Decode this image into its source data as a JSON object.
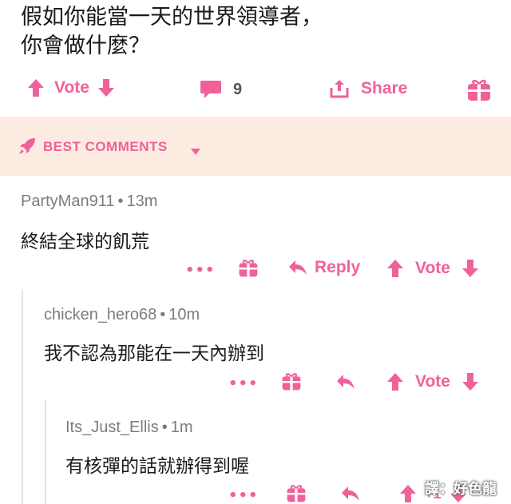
{
  "post": {
    "title": "假如你能當一天的世界領導者，\n你會做什麼？",
    "vote_label": "Vote",
    "comment_count": "9",
    "share_label": "Share"
  },
  "best_comments": {
    "label": "BEST COMMENTS"
  },
  "comments": [
    {
      "user": "PartyMan911",
      "age": "13m",
      "text": "終結全球的飢荒",
      "reply_label": "Reply",
      "vote_label": "Vote"
    },
    {
      "user": "chicken_hero68",
      "age": "10m",
      "text": "我不認為那能在一天內辦到",
      "vote_label": "Vote"
    },
    {
      "user": "Its_Just_Ellis",
      "age": "1m",
      "text": "有核彈的話就辦得到喔",
      "vote_count": "+1"
    }
  ],
  "more_dots": "•••",
  "bullet": "•",
  "watermark": "譯：好色龍",
  "colors": {
    "accent": "#f0619a",
    "best_bar": "#fcebe0",
    "text": "#1a1a1b",
    "meta": "#7c7c7c"
  },
  "icons": [
    "arrow-up-icon",
    "arrow-down-icon",
    "comment-bubble-icon",
    "share-icon",
    "gift-icon",
    "rocket-icon",
    "caret-down-icon",
    "reply-arrow-icon"
  ]
}
